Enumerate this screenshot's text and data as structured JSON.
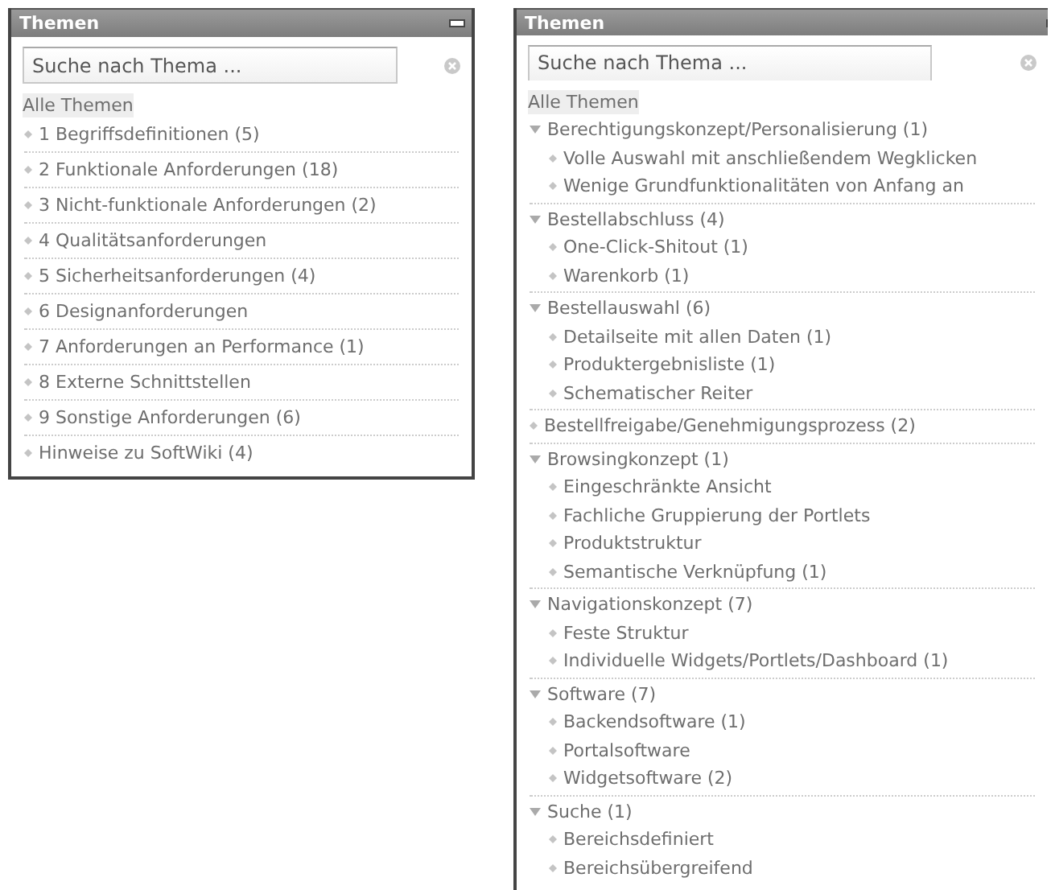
{
  "panels": [
    {
      "title": "Themen",
      "search": {
        "placeholder": "Suche nach Thema ..."
      },
      "all_label": "Alle Themen",
      "kind": "flat",
      "items": [
        {
          "kind": "leaf",
          "label": "1 Begriffsdefinitionen (5)"
        },
        {
          "kind": "leaf",
          "label": "2 Funktionale Anforderungen (18)"
        },
        {
          "kind": "leaf",
          "label": "3 Nicht-funktionale Anforderungen (2)"
        },
        {
          "kind": "leaf",
          "label": "4 Qualitätsanforderungen"
        },
        {
          "kind": "leaf",
          "label": "5 Sicherheitsanforderungen (4)"
        },
        {
          "kind": "leaf",
          "label": "6 Designanforderungen"
        },
        {
          "kind": "leaf",
          "label": "7 Anforderungen an Performance (1)"
        },
        {
          "kind": "leaf",
          "label": "8 Externe Schnittstellen"
        },
        {
          "kind": "leaf",
          "label": "9 Sonstige Anforderungen (6)"
        },
        {
          "kind": "leaf",
          "label": "Hinweise zu SoftWiki (4)"
        }
      ]
    },
    {
      "title": "Themen",
      "search": {
        "placeholder": "Suche nach Thema ..."
      },
      "all_label": "Alle Themen",
      "kind": "tree",
      "items": [
        {
          "kind": "group",
          "expanded": true,
          "label": "Berechtigungskonzept/Personalisierung (1)",
          "children": [
            {
              "label": "Volle Auswahl mit anschließendem Wegklicken"
            },
            {
              "label": "Wenige Grundfunktionalitäten von Anfang an"
            }
          ]
        },
        {
          "kind": "group",
          "expanded": true,
          "label": "Bestellabschluss (4)",
          "children": [
            {
              "label": "One-Click-Shitout (1)"
            },
            {
              "label": "Warenkorb (1)"
            }
          ]
        },
        {
          "kind": "group",
          "expanded": true,
          "label": "Bestellauswahl (6)",
          "children": [
            {
              "label": "Detailseite mit allen Daten (1)"
            },
            {
              "label": "Produktergebnisliste (1)"
            },
            {
              "label": "Schematischer Reiter"
            }
          ]
        },
        {
          "kind": "leaf",
          "label": "Bestellfreigabe/Genehmigungsprozess (2)"
        },
        {
          "kind": "group",
          "expanded": true,
          "label": "Browsingkonzept (1)",
          "children": [
            {
              "label": "Eingeschränkte Ansicht"
            },
            {
              "label": "Fachliche Gruppierung der Portlets"
            },
            {
              "label": "Produktstruktur"
            },
            {
              "label": "Semantische Verknüpfung (1)"
            }
          ]
        },
        {
          "kind": "group",
          "expanded": true,
          "label": "Navigationskonzept (7)",
          "children": [
            {
              "label": "Feste Struktur"
            },
            {
              "label": "Individuelle Widgets/Portlets/Dashboard (1)"
            }
          ]
        },
        {
          "kind": "group",
          "expanded": true,
          "label": "Software (7)",
          "children": [
            {
              "label": "Backendsoftware (1)"
            },
            {
              "label": "Portalsoftware"
            },
            {
              "label": "Widgetsoftware (2)"
            }
          ]
        },
        {
          "kind": "group",
          "expanded": true,
          "label": "Suche (1)",
          "children": [
            {
              "label": "Bereichsdefiniert"
            },
            {
              "label": "Bereichsübergreifend"
            }
          ]
        }
      ]
    }
  ]
}
